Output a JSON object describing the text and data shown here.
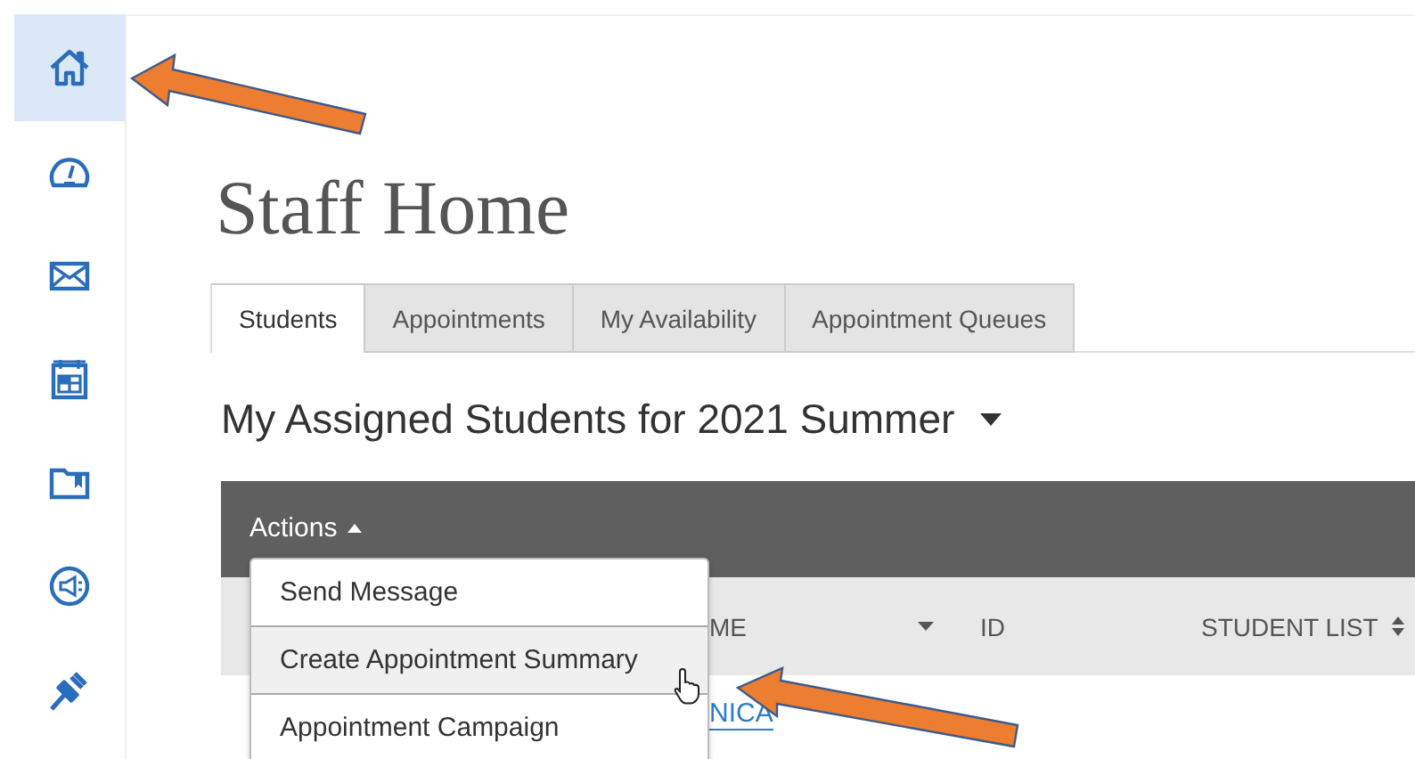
{
  "sidebar": {
    "items": [
      {
        "selected": true
      },
      {
        "selected": false
      },
      {
        "selected": false
      },
      {
        "selected": false
      },
      {
        "selected": false
      },
      {
        "selected": false
      },
      {
        "selected": false
      }
    ]
  },
  "page_title": "Staff Home",
  "tabs": [
    {
      "label": "Students",
      "selected": true
    },
    {
      "label": "Appointments",
      "selected": false
    },
    {
      "label": "My Availability",
      "selected": false
    },
    {
      "label": "Appointment Queues",
      "selected": false
    }
  ],
  "section_title": "My Assigned Students for 2021 Summer",
  "table": {
    "actions_label": "Actions",
    "columns": [
      {
        "label": "ME",
        "kind": "dropdown"
      },
      {
        "label": "ID",
        "kind": "plain"
      },
      {
        "label": "STUDENT LIST",
        "kind": "sort"
      }
    ],
    "rows": [
      {
        "name": "NICA"
      }
    ]
  },
  "actions_menu": {
    "items": [
      {
        "label": "Send Message",
        "selected": false
      },
      {
        "label": "Create Appointment Summary",
        "selected": true
      },
      {
        "label": "Appointment Campaign",
        "selected": false
      }
    ]
  }
}
